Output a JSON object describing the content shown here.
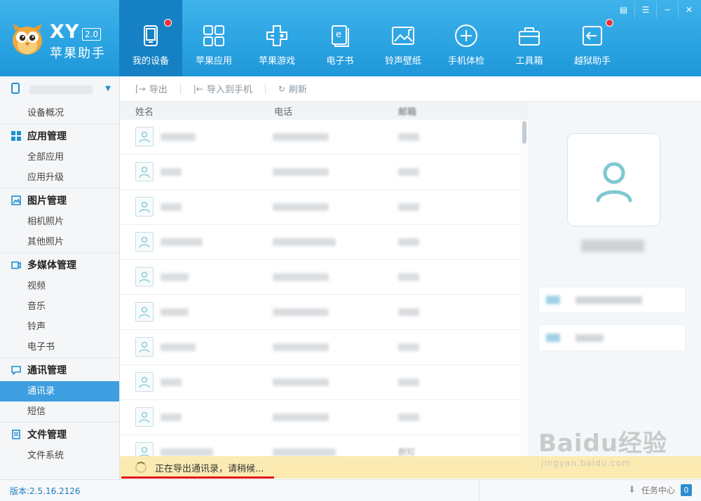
{
  "window": {
    "controls": [
      "menu-icon",
      "skin-icon",
      "minimize-icon",
      "close-icon"
    ]
  },
  "brand": {
    "logo_icon": "owl-logo-icon",
    "title": "XY",
    "version_badge": "2.0",
    "subtitle": "苹果助手"
  },
  "nav": {
    "items": [
      {
        "label": "我的设备",
        "icon": "device-icon",
        "active": true,
        "dot": true
      },
      {
        "label": "苹果应用",
        "icon": "apps-grid-icon",
        "active": false,
        "dot": false
      },
      {
        "label": "苹果游戏",
        "icon": "gamepad-icon",
        "active": false,
        "dot": false
      },
      {
        "label": "电子书",
        "icon": "ebook-icon",
        "active": false,
        "dot": false
      },
      {
        "label": "铃声壁纸",
        "icon": "wallpaper-icon",
        "active": false,
        "dot": false
      },
      {
        "label": "手机体检",
        "icon": "checkup-icon",
        "active": false,
        "dot": false
      },
      {
        "label": "工具箱",
        "icon": "toolbox-icon",
        "active": false,
        "dot": false
      },
      {
        "label": "越狱助手",
        "icon": "jailbreak-icon",
        "active": false,
        "dot": true
      }
    ]
  },
  "sidebar": {
    "overview": "设备概况",
    "groups": [
      {
        "title": "应用管理",
        "icon": "apps-icon",
        "items": [
          "全部应用",
          "应用升级"
        ]
      },
      {
        "title": "图片管理",
        "icon": "image-icon",
        "items": [
          "相机照片",
          "其他照片"
        ]
      },
      {
        "title": "多媒体管理",
        "icon": "media-icon",
        "items": [
          "视频",
          "音乐",
          "铃声",
          "电子书"
        ]
      },
      {
        "title": "通讯管理",
        "icon": "message-icon",
        "items": [
          "通讯录",
          "短信"
        ]
      },
      {
        "title": "文件管理",
        "icon": "file-icon",
        "items": [
          "文件系统"
        ]
      }
    ],
    "active_item": "通讯录"
  },
  "toolbar": {
    "export": "导出",
    "import_to_phone": "导入到手机",
    "refresh": "刷新"
  },
  "contacts": {
    "columns": {
      "name": "姓名",
      "phone": "电话",
      "email": "邮箱"
    },
    "last_row_email_fragment": "删知"
  },
  "export_status": {
    "message": "正在导出通讯录，请稍候..."
  },
  "statusbar": {
    "version": "版本:2.5.16.2126",
    "task_center": "任务中心",
    "task_count": "0"
  },
  "watermark": {
    "line1": "Baidu经验",
    "line2": "jingyan.baidu.com"
  },
  "colors": {
    "topbar": "#2aa3e2",
    "nav_active": "#1581c4",
    "sidebar_active": "#3d9ee0",
    "notification_dot": "#e8323c",
    "export_bar": "#fbebb2",
    "highlight_line": "#e3111a"
  }
}
